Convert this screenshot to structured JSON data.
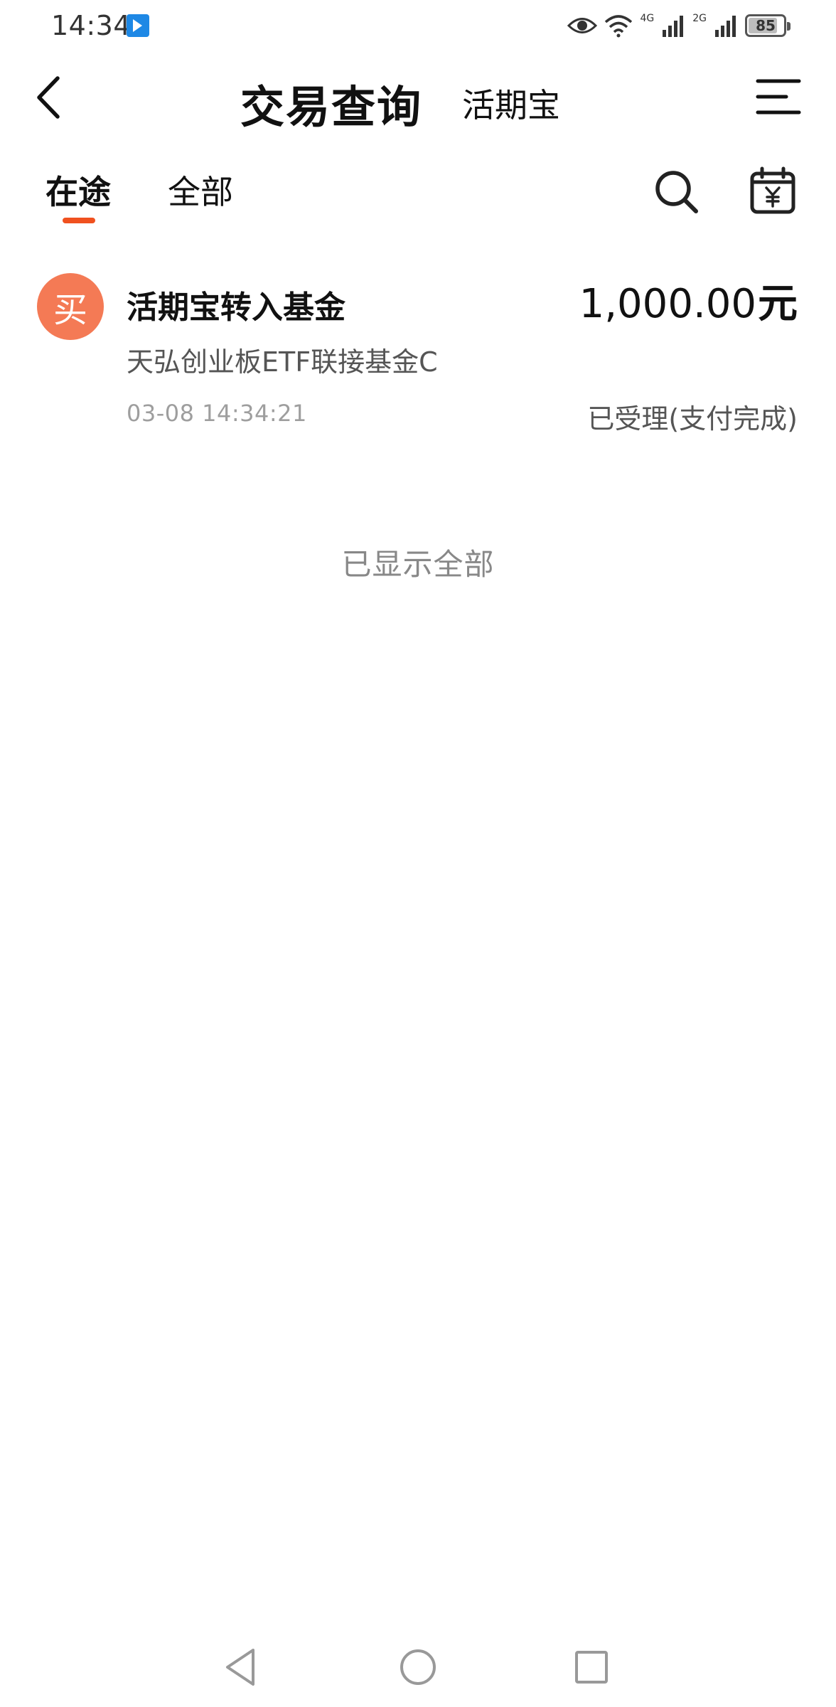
{
  "status_bar": {
    "time": "14:34",
    "net1": "4G",
    "net2": "2G",
    "battery": "85",
    "battery_level": 0.85
  },
  "header": {
    "title": "交易查询",
    "subtitle": "活期宝"
  },
  "tabs": [
    {
      "label": "在途",
      "active": true
    },
    {
      "label": "全部",
      "active": false
    }
  ],
  "accent_color": "#f0511f",
  "transaction": {
    "badge": "买",
    "badge_color": "#f47a55",
    "title": "活期宝转入基金",
    "amount": "1,000.00",
    "amount_unit": "元",
    "fund_name": "天弘创业板ETF联接基金C",
    "time": "03-08 14:34:21",
    "status": "已受理(支付完成)"
  },
  "footer_note": "已显示全部",
  "icons": [
    "back-icon",
    "menu-icon",
    "search-icon",
    "calendar-yuan-icon",
    "eye-icon",
    "wifi-icon",
    "signal-icon",
    "battery-icon",
    "nav-back-icon",
    "nav-home-icon",
    "nav-recent-icon"
  ]
}
